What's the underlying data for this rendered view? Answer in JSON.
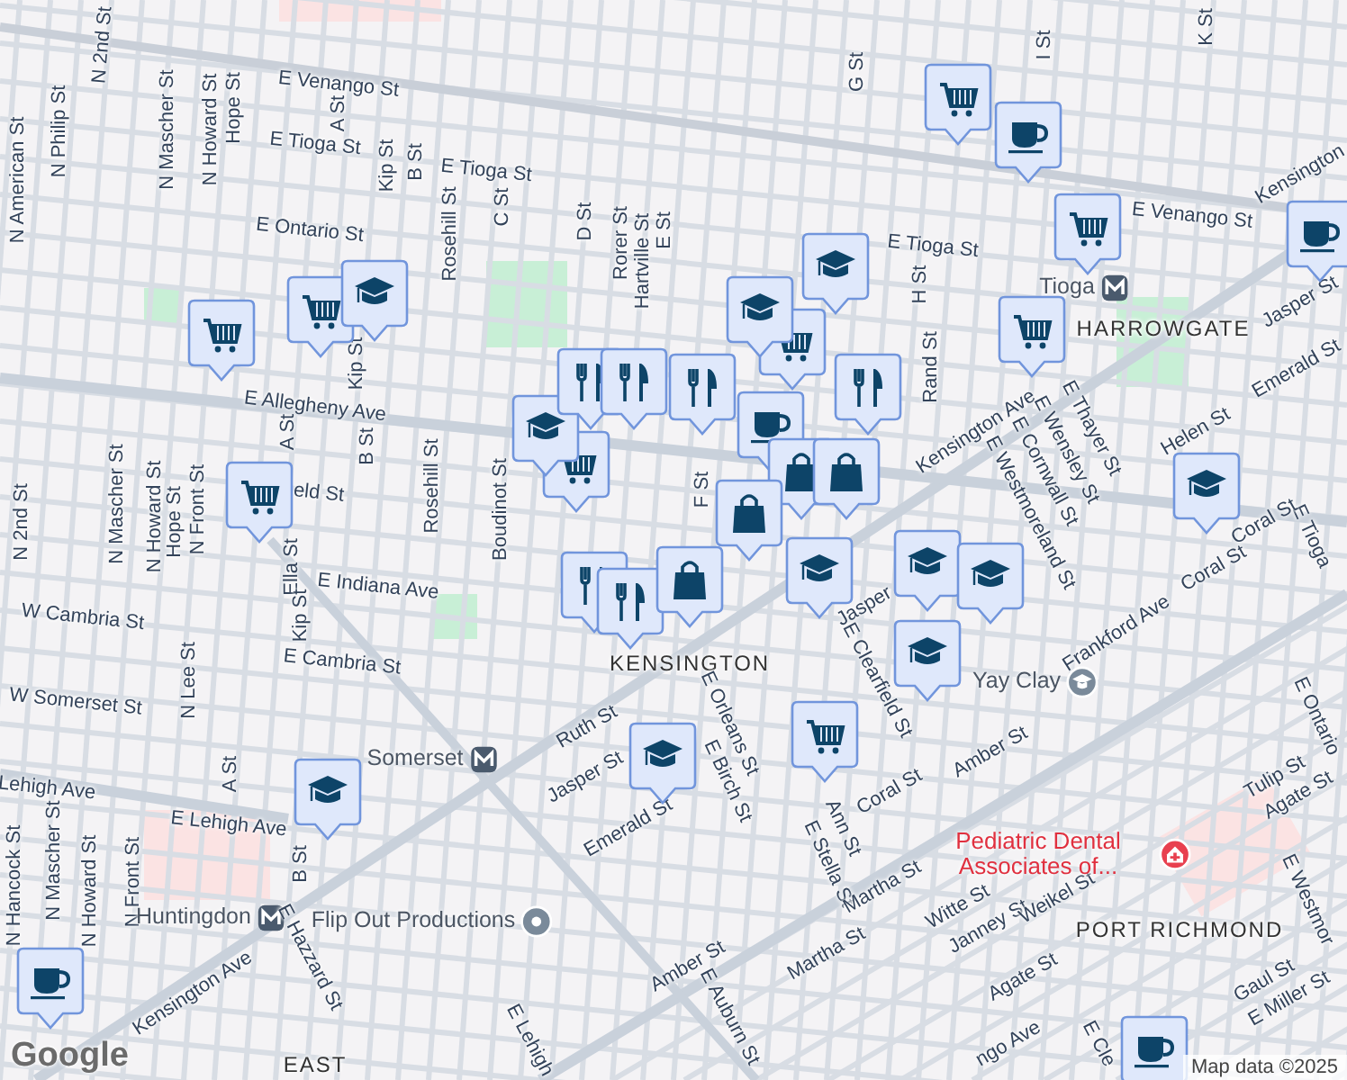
{
  "map": {
    "labels": [
      {
        "text": "E Venango St",
        "kind": "street"
      },
      {
        "text": "N 2nd St",
        "kind": "street"
      },
      {
        "text": "N American St",
        "kind": "street"
      },
      {
        "text": "N Philip St",
        "kind": "street"
      },
      {
        "text": "N Mascher St",
        "kind": "street"
      },
      {
        "text": "N Howard St",
        "kind": "street"
      },
      {
        "text": "Hope St",
        "kind": "street"
      },
      {
        "text": "A St",
        "kind": "street"
      },
      {
        "text": "E Tioga St",
        "kind": "street"
      },
      {
        "text": "Kip St",
        "kind": "street"
      },
      {
        "text": "B St",
        "kind": "street"
      },
      {
        "text": "E Tioga St",
        "kind": "street"
      },
      {
        "text": "Rosehill St",
        "kind": "street"
      },
      {
        "text": "C St",
        "kind": "street"
      },
      {
        "text": "E Ontario St",
        "kind": "street"
      },
      {
        "text": "D St",
        "kind": "street"
      },
      {
        "text": "Rorer St",
        "kind": "street"
      },
      {
        "text": "Hartville St",
        "kind": "street"
      },
      {
        "text": "E St",
        "kind": "street"
      },
      {
        "text": "E Allegheny Ave",
        "kind": "street"
      },
      {
        "text": "Kip St",
        "kind": "street"
      },
      {
        "text": "A St",
        "kind": "street"
      },
      {
        "text": "B St",
        "kind": "street"
      },
      {
        "text": "Rosehill St",
        "kind": "street"
      },
      {
        "text": "Boudinot St",
        "kind": "street"
      },
      {
        "text": "N Mascher St",
        "kind": "street"
      },
      {
        "text": "N Howard St",
        "kind": "street"
      },
      {
        "text": "Hope St",
        "kind": "street"
      },
      {
        "text": "N Front St",
        "kind": "street"
      },
      {
        "text": "N 2nd St",
        "kind": "street"
      },
      {
        "text": "eld St",
        "kind": "street"
      },
      {
        "text": "G St",
        "kind": "street"
      },
      {
        "text": "I St",
        "kind": "street"
      },
      {
        "text": "K St",
        "kind": "street"
      },
      {
        "text": "E Venango St",
        "kind": "street"
      },
      {
        "text": "E Tioga St",
        "kind": "street"
      },
      {
        "text": "H St",
        "kind": "street"
      },
      {
        "text": "Rand St",
        "kind": "street"
      },
      {
        "text": "Tioga",
        "kind": "station"
      },
      {
        "text": "HARROWGATE",
        "kind": "area"
      },
      {
        "text": "Kensington Ave",
        "kind": "street"
      },
      {
        "text": "E Thayer St",
        "kind": "street"
      },
      {
        "text": "E Wensley St",
        "kind": "street"
      },
      {
        "text": "E Cornwall St",
        "kind": "street"
      },
      {
        "text": "E Westmoreland St",
        "kind": "street"
      },
      {
        "text": "Helen St",
        "kind": "street"
      },
      {
        "text": "Emerald St",
        "kind": "street"
      },
      {
        "text": "Jasper St",
        "kind": "street"
      },
      {
        "text": "Kensington",
        "kind": "street"
      },
      {
        "text": "E Tioga",
        "kind": "street"
      },
      {
        "text": "Coral St",
        "kind": "street"
      },
      {
        "text": "Frankford Ave",
        "kind": "street"
      },
      {
        "text": "Coral St",
        "kind": "street"
      },
      {
        "text": "E Indiana Ave",
        "kind": "street"
      },
      {
        "text": "Ella St",
        "kind": "street"
      },
      {
        "text": "Kip St",
        "kind": "street"
      },
      {
        "text": "W Cambria St",
        "kind": "street"
      },
      {
        "text": "E Cambria St",
        "kind": "street"
      },
      {
        "text": "W Somerset St",
        "kind": "street"
      },
      {
        "text": "N Lee St",
        "kind": "street"
      },
      {
        "text": "A St",
        "kind": "street"
      },
      {
        "text": "Lehigh Ave",
        "kind": "street"
      },
      {
        "text": "E Lehigh Ave",
        "kind": "street"
      },
      {
        "text": "N Hancock St",
        "kind": "street"
      },
      {
        "text": "N Mascher St",
        "kind": "street"
      },
      {
        "text": "N Howard St",
        "kind": "street"
      },
      {
        "text": "N Front St",
        "kind": "street"
      },
      {
        "text": "B St",
        "kind": "street"
      },
      {
        "text": "Somerset",
        "kind": "station"
      },
      {
        "text": "Huntingdon",
        "kind": "station"
      },
      {
        "text": "Flip Out Productions",
        "kind": "place"
      },
      {
        "text": "Kensington Ave",
        "kind": "street"
      },
      {
        "text": "E Hazzard St",
        "kind": "street"
      },
      {
        "text": "EAST",
        "kind": "area"
      },
      {
        "text": "E Lehigh",
        "kind": "street"
      },
      {
        "text": "KENSINGTON",
        "kind": "area"
      },
      {
        "text": "Ruth St",
        "kind": "street"
      },
      {
        "text": "Jasper St",
        "kind": "street"
      },
      {
        "text": "Emerald St",
        "kind": "street"
      },
      {
        "text": "E Orleans St",
        "kind": "street"
      },
      {
        "text": "E Birch St",
        "kind": "street"
      },
      {
        "text": "Amber St",
        "kind": "street"
      },
      {
        "text": "E Auburn St",
        "kind": "street"
      },
      {
        "text": "E Clearfield St",
        "kind": "street"
      },
      {
        "text": "Jasper",
        "kind": "street"
      },
      {
        "text": "Coral St",
        "kind": "street"
      },
      {
        "text": "Amber St",
        "kind": "street"
      },
      {
        "text": "Ann St",
        "kind": "street"
      },
      {
        "text": "E Stella St",
        "kind": "street"
      },
      {
        "text": "Martha St",
        "kind": "street"
      },
      {
        "text": "Martha St",
        "kind": "street"
      },
      {
        "text": "Witte St",
        "kind": "street"
      },
      {
        "text": "Janney St",
        "kind": "street"
      },
      {
        "text": "Weikel St",
        "kind": "street"
      },
      {
        "text": "Yay Clay",
        "kind": "school-place"
      },
      {
        "text": "Pediatric Dental Associates of...",
        "kind": "medical-place"
      },
      {
        "text": "PORT RICHMOND",
        "kind": "area"
      },
      {
        "text": "Agate St",
        "kind": "street"
      },
      {
        "text": "Tulip St",
        "kind": "street"
      },
      {
        "text": "Agate St",
        "kind": "street"
      },
      {
        "text": "E Ontario",
        "kind": "street"
      },
      {
        "text": "E Westmor",
        "kind": "street"
      },
      {
        "text": "Gaul St",
        "kind": "street"
      },
      {
        "text": "E Miller St",
        "kind": "street"
      },
      {
        "text": "ngo Ave",
        "kind": "street"
      },
      {
        "text": "E Cle",
        "kind": "street"
      },
      {
        "text": "F St",
        "kind": "street"
      }
    ],
    "markers": [
      {
        "kind": "cart"
      },
      {
        "kind": "cart"
      },
      {
        "kind": "cart"
      },
      {
        "kind": "cart"
      },
      {
        "kind": "cart"
      },
      {
        "kind": "cart"
      },
      {
        "kind": "cart"
      },
      {
        "kind": "cart"
      },
      {
        "kind": "cart"
      },
      {
        "kind": "cup"
      },
      {
        "kind": "cup"
      },
      {
        "kind": "cup"
      },
      {
        "kind": "cup"
      },
      {
        "kind": "cup"
      },
      {
        "kind": "cap"
      },
      {
        "kind": "cap"
      },
      {
        "kind": "cap"
      },
      {
        "kind": "cap"
      },
      {
        "kind": "cap"
      },
      {
        "kind": "cap"
      },
      {
        "kind": "cap"
      },
      {
        "kind": "cap"
      },
      {
        "kind": "cap"
      },
      {
        "kind": "cap"
      },
      {
        "kind": "cap"
      },
      {
        "kind": "dining"
      },
      {
        "kind": "dining"
      },
      {
        "kind": "dining"
      },
      {
        "kind": "dining"
      },
      {
        "kind": "dining"
      },
      {
        "kind": "dining"
      },
      {
        "kind": "bag"
      },
      {
        "kind": "bag"
      },
      {
        "kind": "bag"
      },
      {
        "kind": "bag"
      }
    ]
  },
  "logo": "Google",
  "attribution": "Map data ©2025"
}
